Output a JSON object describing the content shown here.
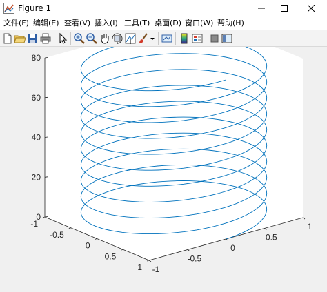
{
  "window": {
    "title": "Figure 1"
  },
  "menu": [
    {
      "label": "文件(F)"
    },
    {
      "label": "编辑(E)"
    },
    {
      "label": "查看(V)"
    },
    {
      "label": "插入(I)"
    },
    {
      "label": "工具(T)"
    },
    {
      "label": "桌面(D)"
    },
    {
      "label": "窗口(W)"
    },
    {
      "label": "帮助(H)"
    }
  ],
  "toolbar_icons": [
    "new-figure-icon",
    "open-file-icon",
    "save-icon",
    "print-icon",
    "edit-plot-arrow-icon",
    "zoom-in-icon",
    "zoom-out-icon",
    "pan-hand-icon",
    "rotate-3d-icon",
    "data-cursor-icon",
    "brush-icon",
    "brush-dropdown-icon",
    "link-plot-icon",
    "insert-colorbar-icon",
    "insert-legend-icon",
    "hide-plot-tools-icon",
    "show-plot-tools-icon"
  ],
  "colors": {
    "line": "#0072BD",
    "axes_bg": "#ffffff",
    "figure_bg": "#f0f0f0"
  },
  "chart_data": {
    "type": "line",
    "subtype": "3d-helix",
    "description_of_data": "z from 0 to 80, x = sin(t), y = cos(t), approx 10 turns",
    "x_function": "sin(t)",
    "y_function": "cos(t)",
    "z_range": [
      0,
      80
    ],
    "turns": 10,
    "xlim": [
      -1,
      1
    ],
    "ylim": [
      -1,
      1
    ],
    "zlim": [
      0,
      80
    ],
    "x_ticks": [
      "-1",
      "-0.5",
      "0",
      "0.5",
      "1"
    ],
    "y_ticks": [
      "1",
      "0.5",
      "0",
      "-0.5",
      "-1"
    ],
    "z_ticks": [
      "0",
      "20",
      "40",
      "60",
      "80"
    ],
    "grid": false,
    "box": false,
    "title": "",
    "xlabel": "",
    "ylabel": "",
    "zlabel": ""
  }
}
